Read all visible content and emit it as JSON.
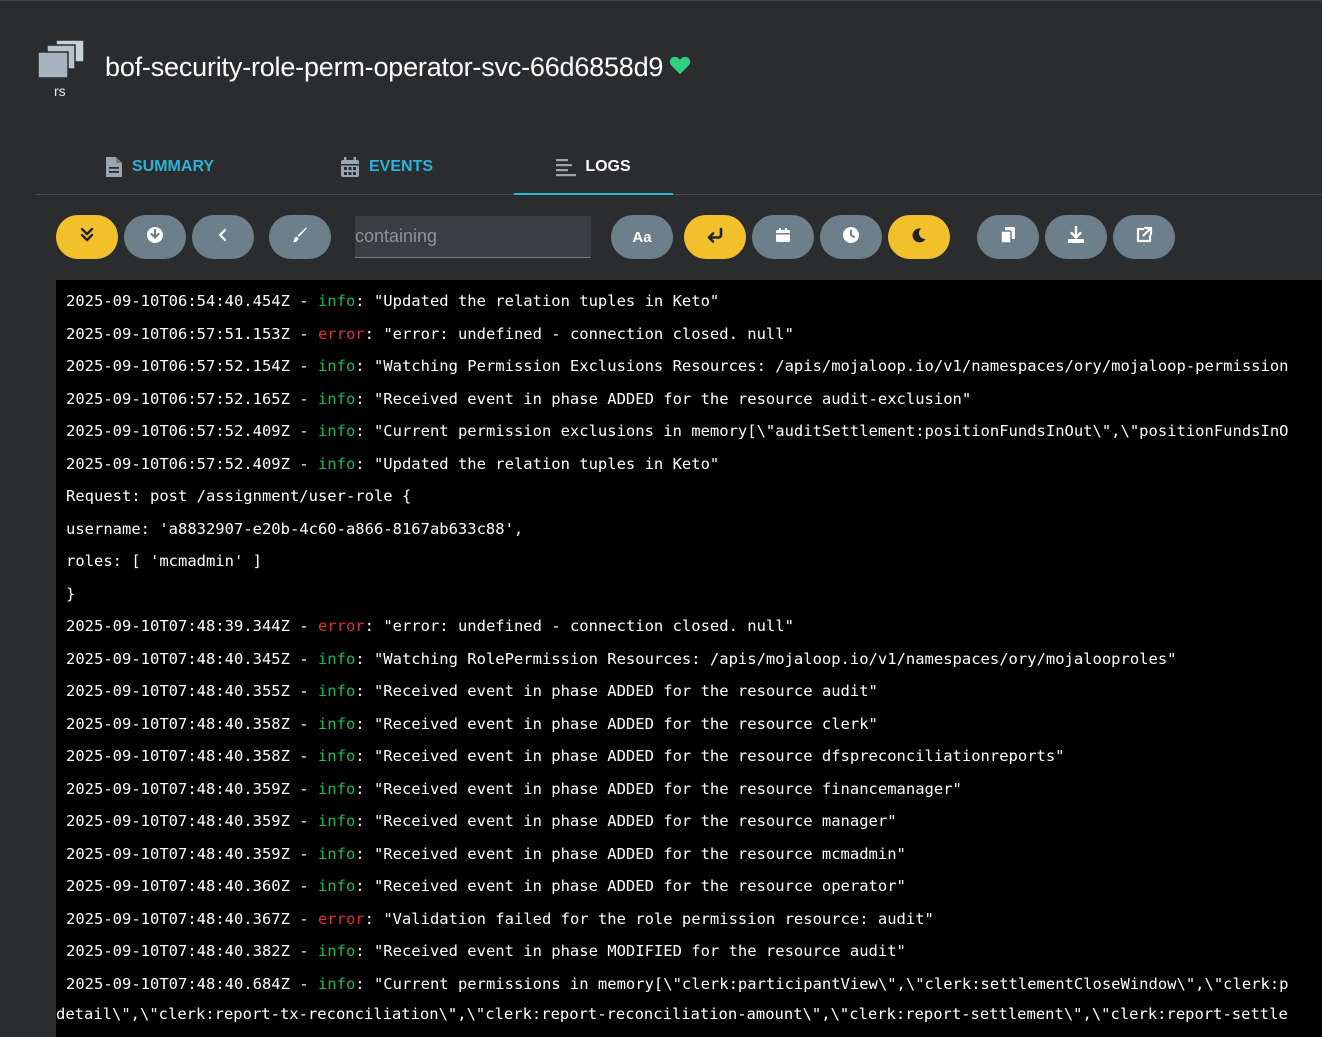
{
  "header": {
    "kind_label": "rs",
    "title": "bof-security-role-perm-operator-svc-66d6858d9",
    "health_icon": "heart-icon",
    "health_color": "#2ed082"
  },
  "tabs": [
    {
      "label": "SUMMARY",
      "icon": "file-icon"
    },
    {
      "label": "EVENTS",
      "icon": "calendar-icon"
    },
    {
      "label": "LOGS",
      "icon": "lines-icon",
      "active": true
    }
  ],
  "toolbar": {
    "search_placeholder": "containing",
    "case_label": "Aa",
    "buttons": [
      {
        "icon": "follow-icon",
        "active": true
      },
      {
        "icon": "download-circle-icon",
        "active": false
      },
      {
        "icon": "chevron-left-icon",
        "active": false
      },
      {
        "icon": "brush-icon",
        "active": false
      },
      {
        "icon": "case-sensitive-icon",
        "active": false
      },
      {
        "icon": "wrap-lines-icon",
        "active": true
      },
      {
        "icon": "calendar-icon",
        "active": false
      },
      {
        "icon": "clock-icon",
        "active": false
      },
      {
        "icon": "dark-mode-icon",
        "active": true
      },
      {
        "icon": "copy-icon",
        "active": false
      },
      {
        "icon": "download-icon",
        "active": false
      },
      {
        "icon": "open-external-icon",
        "active": false
      }
    ]
  },
  "colors": {
    "accent": "#2bb3d9",
    "active_button": "#f2c02b",
    "button": "#6d7f8b",
    "info": "#18be52",
    "error": "#e03030"
  },
  "logs": [
    {
      "ts": "2025-09-10T06:54:40.454Z",
      "level": "info",
      "msg": "\"Updated the relation tuples in Keto\""
    },
    {
      "ts": "2025-09-10T06:57:51.153Z",
      "level": "error",
      "msg": "\"error: undefined - connection closed. null\""
    },
    {
      "ts": "2025-09-10T06:57:52.154Z",
      "level": "info",
      "msg": "\"Watching Permission Exclusions Resources: /apis/mojaloop.io/v1/namespaces/ory/mojaloop-permission"
    },
    {
      "ts": "2025-09-10T06:57:52.165Z",
      "level": "info",
      "msg": "\"Received event in phase ADDED for the resource audit-exclusion\""
    },
    {
      "ts": "2025-09-10T06:57:52.409Z",
      "level": "info",
      "msg": "\"Current permission exclusions in memory[\\\"auditSettlement:positionFundsInOut\\\",\\\"positionFundsInO"
    },
    {
      "ts": "2025-09-10T06:57:52.409Z",
      "level": "info",
      "msg": "\"Updated the relation tuples in Keto\""
    },
    {
      "raw": "Request: post /assignment/user-role {"
    },
    {
      "raw": "username: 'a8832907-e20b-4c60-a866-8167ab633c88',"
    },
    {
      "raw": "roles: [ 'mcmadmin' ]"
    },
    {
      "raw": "}"
    },
    {
      "ts": "2025-09-10T07:48:39.344Z",
      "level": "error",
      "msg": "\"error: undefined - connection closed. null\""
    },
    {
      "ts": "2025-09-10T07:48:40.345Z",
      "level": "info",
      "msg": "\"Watching RolePermission Resources: /apis/mojaloop.io/v1/namespaces/ory/mojalooproles\""
    },
    {
      "ts": "2025-09-10T07:48:40.355Z",
      "level": "info",
      "msg": "\"Received event in phase ADDED for the resource audit\""
    },
    {
      "ts": "2025-09-10T07:48:40.358Z",
      "level": "info",
      "msg": "\"Received event in phase ADDED for the resource clerk\""
    },
    {
      "ts": "2025-09-10T07:48:40.358Z",
      "level": "info",
      "msg": "\"Received event in phase ADDED for the resource dfspreconciliationreports\""
    },
    {
      "ts": "2025-09-10T07:48:40.359Z",
      "level": "info",
      "msg": "\"Received event in phase ADDED for the resource financemanager\""
    },
    {
      "ts": "2025-09-10T07:48:40.359Z",
      "level": "info",
      "msg": "\"Received event in phase ADDED for the resource manager\""
    },
    {
      "ts": "2025-09-10T07:48:40.359Z",
      "level": "info",
      "msg": "\"Received event in phase ADDED for the resource mcmadmin\""
    },
    {
      "ts": "2025-09-10T07:48:40.360Z",
      "level": "info",
      "msg": "\"Received event in phase ADDED for the resource operator\""
    },
    {
      "ts": "2025-09-10T07:48:40.367Z",
      "level": "error",
      "msg": "\"Validation failed for the role permission resource: audit\""
    },
    {
      "ts": "2025-09-10T07:48:40.382Z",
      "level": "info",
      "msg": "\"Received event in phase MODIFIED for the resource audit\""
    },
    {
      "ts": "2025-09-10T07:48:40.684Z",
      "level": "info",
      "msg": "\"Current permissions in memory[\\\"clerk:participantView\\\",\\\"clerk:settlementCloseWindow\\\",\\\"clerk:p"
    },
    {
      "wrap": "detail\\\",\\\"clerk:report-tx-reconciliation\\\",\\\"clerk:report-reconciliation-amount\\\",\\\"clerk:report-settlement\\\",\\\"clerk:report-settle"
    }
  ]
}
